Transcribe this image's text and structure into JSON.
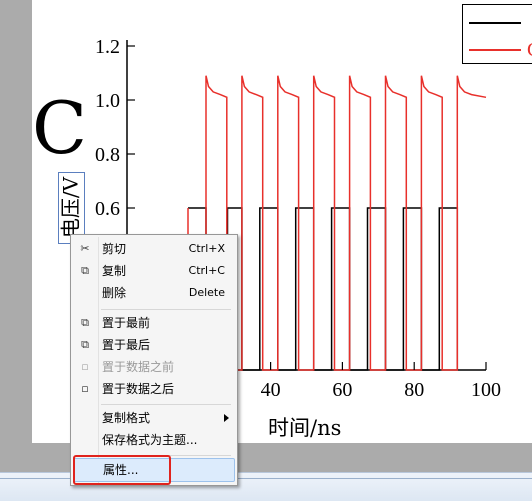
{
  "chart": {
    "panel_letter": "C",
    "ylabel": "电压/V",
    "xlabel": "时间/ns",
    "x_ticks": [
      "40",
      "60",
      "80",
      "100"
    ],
    "y_ticks": [
      "1.2",
      "1.0",
      "0.8",
      "0.6"
    ],
    "legend": [
      {
        "text": "",
        "color": "#000000"
      },
      {
        "text": "C",
        "color": "#e8302b"
      }
    ]
  },
  "chart_data": {
    "type": "line",
    "xlabel": "时间/ns",
    "ylabel": "电压/V",
    "xlim": [
      0,
      100
    ],
    "ylim": [
      0,
      1.2
    ],
    "y_ticks_visible": [
      0.6,
      0.8,
      1.0,
      1.2
    ],
    "x_ticks_visible": [
      40,
      60,
      80,
      100
    ],
    "grid": false,
    "legend_position": "top-right",
    "series": [
      {
        "color": "#000000",
        "points": [
          [
            17,
            0.6
          ],
          [
            22,
            0.6
          ],
          [
            22,
            0
          ],
          [
            28,
            0
          ],
          [
            28,
            0.6
          ],
          [
            32,
            0.6
          ],
          [
            32,
            0
          ],
          [
            37,
            0
          ],
          [
            37,
            0.6
          ],
          [
            42,
            0.6
          ],
          [
            42,
            0
          ],
          [
            47,
            0
          ],
          [
            47,
            0.6
          ],
          [
            52,
            0.6
          ],
          [
            52,
            0
          ],
          [
            57,
            0
          ],
          [
            57,
            0.6
          ],
          [
            62,
            0.6
          ],
          [
            62,
            0
          ],
          [
            67,
            0
          ],
          [
            67,
            0.6
          ],
          [
            72,
            0.6
          ],
          [
            72,
            0
          ],
          [
            77,
            0
          ],
          [
            77,
            0.6
          ],
          [
            82,
            0.6
          ],
          [
            82,
            0
          ],
          [
            87,
            0
          ],
          [
            87,
            0.6
          ],
          [
            92,
            0.6
          ],
          [
            92,
            0
          ]
        ]
      },
      {
        "color": "#e8302b",
        "points": [
          [
            17,
            0.6
          ],
          [
            17,
            0
          ],
          [
            22,
            0
          ],
          [
            22,
            1.09
          ],
          [
            22.7,
            1.05
          ],
          [
            24,
            1.03
          ],
          [
            26,
            1.02
          ],
          [
            27.8,
            1.01
          ],
          [
            27.8,
            0
          ],
          [
            32,
            0
          ],
          [
            32,
            1.09
          ],
          [
            32.7,
            1.05
          ],
          [
            34,
            1.03
          ],
          [
            36,
            1.02
          ],
          [
            37.8,
            1.01
          ],
          [
            37.8,
            0
          ],
          [
            42,
            0
          ],
          [
            42,
            1.09
          ],
          [
            42.7,
            1.05
          ],
          [
            44,
            1.03
          ],
          [
            46,
            1.02
          ],
          [
            47.8,
            1.01
          ],
          [
            47.8,
            0
          ],
          [
            52,
            0
          ],
          [
            52,
            1.09
          ],
          [
            52.7,
            1.05
          ],
          [
            54,
            1.03
          ],
          [
            56,
            1.02
          ],
          [
            57.8,
            1.01
          ],
          [
            57.8,
            0
          ],
          [
            62,
            0
          ],
          [
            62,
            1.09
          ],
          [
            62.7,
            1.05
          ],
          [
            64,
            1.03
          ],
          [
            66,
            1.02
          ],
          [
            67.8,
            1.01
          ],
          [
            67.8,
            0
          ],
          [
            72,
            0
          ],
          [
            72,
            1.09
          ],
          [
            72.7,
            1.05
          ],
          [
            74,
            1.03
          ],
          [
            76,
            1.02
          ],
          [
            77.8,
            1.01
          ],
          [
            77.8,
            0
          ],
          [
            82,
            0
          ],
          [
            82,
            1.09
          ],
          [
            82.7,
            1.05
          ],
          [
            84,
            1.03
          ],
          [
            86,
            1.02
          ],
          [
            87.8,
            1.01
          ],
          [
            87.8,
            0
          ],
          [
            92,
            0
          ],
          [
            92,
            1.09
          ],
          [
            92.7,
            1.05
          ],
          [
            94,
            1.03
          ],
          [
            96,
            1.02
          ],
          [
            100,
            1.01
          ]
        ]
      }
    ]
  },
  "context_menu": {
    "items": [
      {
        "icon": "scissors-icon",
        "glyph": "✂",
        "label": "剪切",
        "shortcut": "Ctrl+X",
        "enabled": true
      },
      {
        "icon": "copy-icon",
        "glyph": "⧉",
        "label": "复制",
        "shortcut": "Ctrl+C",
        "enabled": true
      },
      {
        "icon": "",
        "glyph": "",
        "label": "删除",
        "shortcut": "Delete",
        "enabled": true
      },
      {
        "icon": "bring-to-front-icon",
        "glyph": "⧉",
        "label": "置于最前",
        "shortcut": "",
        "enabled": true
      },
      {
        "icon": "send-to-back-icon",
        "glyph": "⧉",
        "label": "置于最后",
        "shortcut": "",
        "enabled": true
      },
      {
        "icon": "before-data-icon",
        "glyph": "▫",
        "label": "置于数据之前",
        "shortcut": "",
        "enabled": false
      },
      {
        "icon": "after-data-icon",
        "glyph": "▫",
        "label": "置于数据之后",
        "shortcut": "",
        "enabled": true
      },
      {
        "icon": "",
        "glyph": "",
        "label": "复制格式",
        "shortcut": "",
        "enabled": true,
        "submenu": true
      },
      {
        "icon": "",
        "glyph": "",
        "label": "保存格式为主题...",
        "shortcut": "",
        "enabled": true
      },
      {
        "icon": "",
        "glyph": "",
        "label": "属性...",
        "shortcut": "",
        "enabled": true,
        "highlighted": true
      }
    ]
  },
  "colors": {
    "signal_black": "#000000",
    "signal_red": "#e8302b",
    "highlight_red": "#e0231d",
    "desktop_gray": "#ababab",
    "selection_blue": "#dcebfc"
  }
}
